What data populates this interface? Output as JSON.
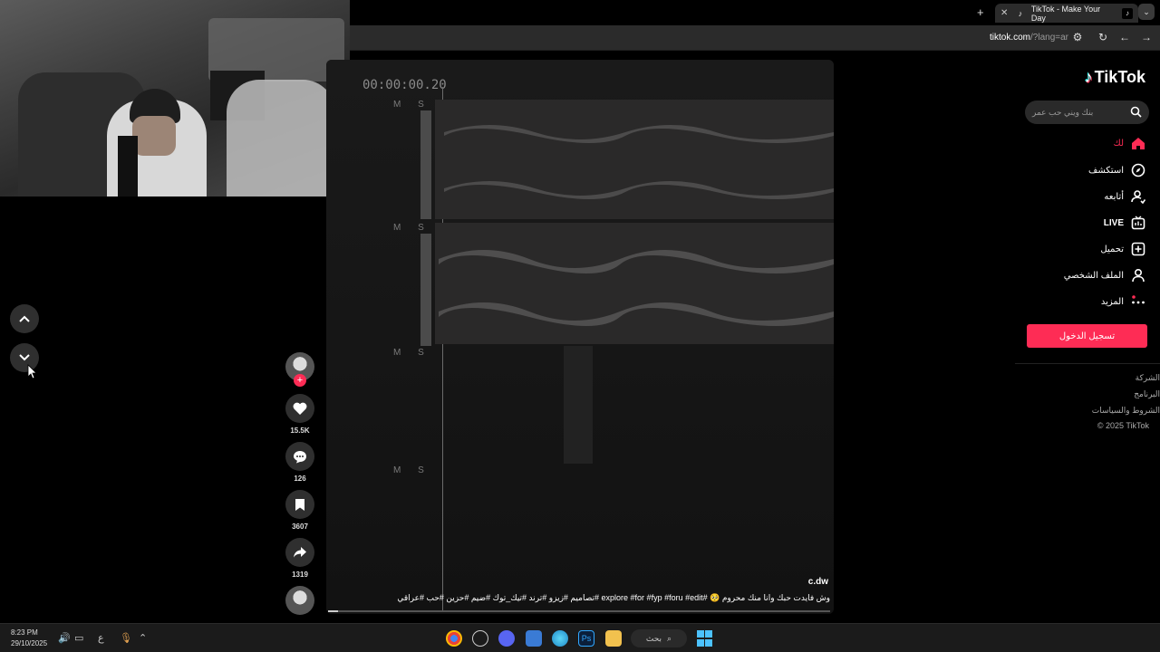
{
  "browser": {
    "tab_title": "TikTok - Make Your Day",
    "url_host": "tiktok.com",
    "url_path": "/?lang=ar"
  },
  "video": {
    "timecode": "00:00:00.20",
    "ms_label": "M S",
    "author": "c.dw",
    "caption": "وش فايدت حبك وانا منك محروم 🥺 #explore #for #fyp #foru #edit #تصاميم #زيزو #ترند #تيك_توك #ضيم #حزين #حب #عراقي",
    "progress": 0.02
  },
  "actions": {
    "likes": "15.5K",
    "comments": "126",
    "saves": "3607",
    "shares": "1319"
  },
  "sidebar": {
    "logo_text": "TikTok",
    "search_placeholder": "بنك ويني حب عمر",
    "items": [
      {
        "label": "لك",
        "icon": "home-icon"
      },
      {
        "label": "استكشف",
        "icon": "compass-icon"
      },
      {
        "label": "أتابعه",
        "icon": "following-icon"
      },
      {
        "label": "LIVE",
        "icon": "live-icon"
      },
      {
        "label": "تحميل",
        "icon": "upload-icon"
      },
      {
        "label": "الملف الشخصي",
        "icon": "profile-icon"
      },
      {
        "label": "المزيد",
        "icon": "more-icon"
      }
    ],
    "login_label": "تسجيل الدخول",
    "footer": [
      "الشركة",
      "البرنامج",
      "الشروط والسياسات",
      "© 2025 TikTok"
    ]
  },
  "taskbar": {
    "time": "8:23 PM",
    "date": "29/10/2025",
    "search_label": "بحث",
    "lang": "ع"
  },
  "colors": {
    "accent": "#fe2c55",
    "page_bg": "#000000"
  }
}
